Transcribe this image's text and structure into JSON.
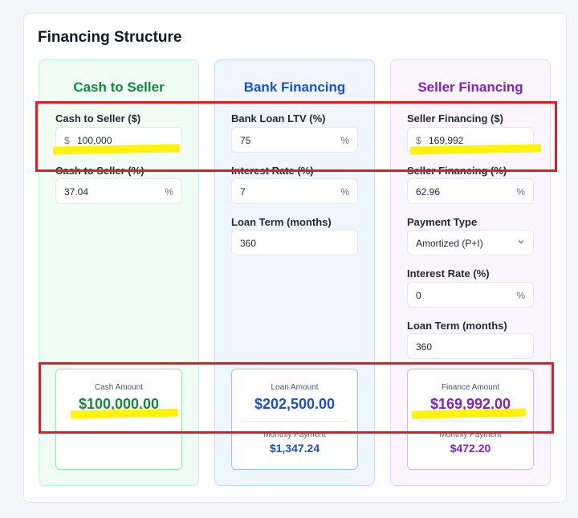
{
  "page": {
    "title": "Financing Structure"
  },
  "colors": {
    "cash": "#16873e",
    "bank": "#1d4ed8",
    "seller": "#7e22ce",
    "annotation_box": "#e31b23",
    "annotation_highlight": "#fff200"
  },
  "cash_column": {
    "title": "Cash to Seller",
    "cash_amount_label": "Cash to Seller ($)",
    "cash_amount_prefix": "$",
    "cash_amount_value": "100,000",
    "cash_percent_label": "Cash to Seller (%)",
    "cash_percent_value": "37.04",
    "cash_percent_suffix": "%",
    "result_label": "Cash Amount",
    "result_amount": "$100,000.00"
  },
  "bank_column": {
    "title": "Bank Financing",
    "ltv_label": "Bank Loan LTV (%)",
    "ltv_value": "75",
    "ltv_suffix": "%",
    "rate_label": "Interest Rate (%)",
    "rate_value": "7",
    "rate_suffix": "%",
    "term_label": "Loan Term (months)",
    "term_value": "360",
    "result_label": "Loan Amount",
    "result_amount": "$202,500.00",
    "monthly_label": "Monthly Payment",
    "monthly_amount": "$1,347.24"
  },
  "seller_column": {
    "title": "Seller Financing",
    "amount_label": "Seller Financing ($)",
    "amount_prefix": "$",
    "amount_value": "169,992",
    "percent_label": "Seller Financing (%)",
    "percent_value": "62.96",
    "percent_suffix": "%",
    "payment_type_label": "Payment Type",
    "payment_type_value": "Amortized (P+I)",
    "rate_label": "Interest Rate (%)",
    "rate_value": "0",
    "rate_suffix": "%",
    "term_label": "Loan Term (months)",
    "term_value": "360",
    "result_label": "Finance Amount",
    "result_amount": "$169,992.00",
    "monthly_label": "Monthly Payment",
    "monthly_amount": "$472.20"
  }
}
